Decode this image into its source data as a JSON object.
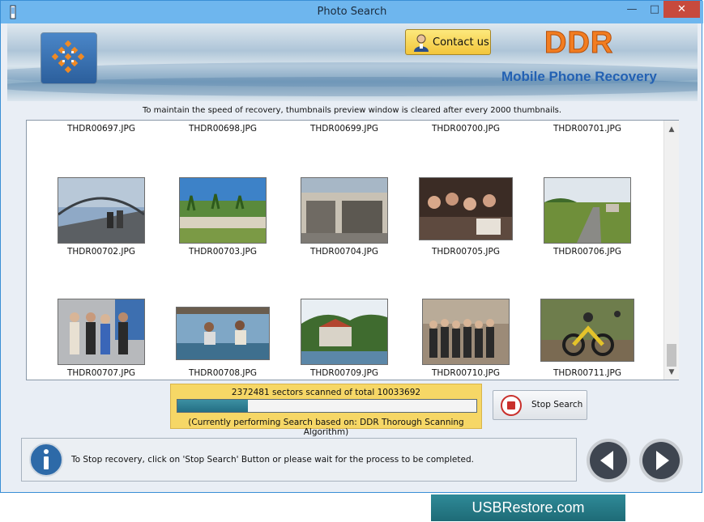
{
  "window": {
    "title": "Photo Search"
  },
  "header": {
    "contact_label": "Contact us",
    "logo_text": "DDR",
    "product_name": "Mobile Phone Recovery"
  },
  "notice": "To maintain the speed of recovery, thumbnails preview window is cleared after every 2000 thumbnails.",
  "thumbnails": [
    {
      "name": "THDR00697.JPG",
      "image": ""
    },
    {
      "name": "THDR00698.JPG",
      "image": ""
    },
    {
      "name": "THDR00699.JPG",
      "image": ""
    },
    {
      "name": "THDR00700.JPG",
      "image": ""
    },
    {
      "name": "THDR00701.JPG",
      "image": ""
    },
    {
      "name": "THDR00702.JPG",
      "image": "bridge-cyclists"
    },
    {
      "name": "THDR00703.JPG",
      "image": "beach-palms"
    },
    {
      "name": "THDR00704.JPG",
      "image": "storefront"
    },
    {
      "name": "THDR00705.JPG",
      "image": "crowd-indoors"
    },
    {
      "name": "THDR00706.JPG",
      "image": "country-road"
    },
    {
      "name": "THDR00707.JPG",
      "image": "group-office"
    },
    {
      "name": "THDR00708.JPG",
      "image": "boat-people"
    },
    {
      "name": "THDR00709.JPG",
      "image": "hillside-building"
    },
    {
      "name": "THDR00710.JPG",
      "image": "group-photo"
    },
    {
      "name": "THDR00711.JPG",
      "image": "motocross"
    }
  ],
  "progress": {
    "scanned_text": "2372481 sectors scanned of total 10033692",
    "fraction": 0.2365,
    "algorithm_text": "(Currently performing Search based on:  DDR Thorough Scanning Algorithm)"
  },
  "stop_button_label": "Stop Search",
  "info_text": "To Stop recovery, click on 'Stop Search' Button or please wait for the process to be completed.",
  "brand_text": "USBRestore.com",
  "colors": {
    "titlebar": "#6eb6ee",
    "close": "#c74a3d",
    "ddr_orange": "#f27d21",
    "product_blue": "#2361b3",
    "progress_bg": "#f6d766",
    "progress_fill": "#2a7b8f",
    "brand_bar": "#267c89"
  }
}
